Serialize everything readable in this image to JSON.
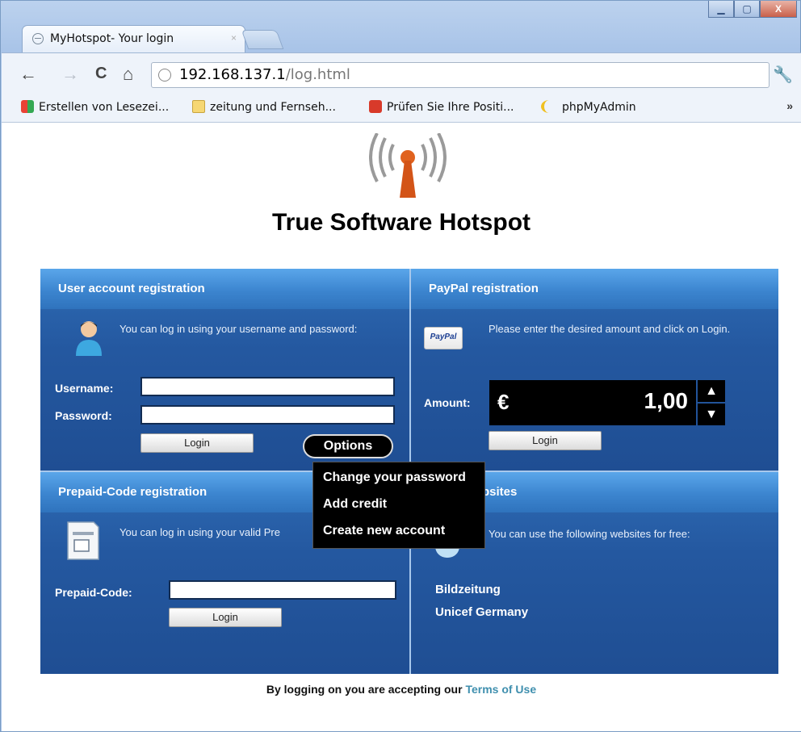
{
  "window": {
    "tab_title": "MyHotspot- Your login",
    "tab_close": "×",
    "minimize": "▁",
    "maximize": "▢",
    "close": "X"
  },
  "toolbar": {
    "url_host": "192.168.137.1",
    "url_path": "/log.html",
    "back": "←",
    "forward": "→",
    "reload": "C",
    "home": "⌂",
    "settings": "🔧"
  },
  "bookmarks": {
    "items": [
      {
        "label": "Erstellen von Lesezei...",
        "icon": "google-apps-icon"
      },
      {
        "label": "zeitung und Fernseh...",
        "icon": "folder-icon"
      },
      {
        "label": "Prüfen Sie Ihre Positi...",
        "icon": "chart-icon"
      },
      {
        "label": "phpMyAdmin",
        "icon": "phpmyadmin-icon"
      }
    ],
    "more": "»"
  },
  "page": {
    "site_title": "True Software Hotspot",
    "user_panel": {
      "title": "User account registration",
      "description": "You can log in using your username and password:",
      "username_label": "Username:",
      "username_value": "",
      "password_label": "Password:",
      "password_value": "",
      "login_label": "Login",
      "options_label": "Options"
    },
    "options_menu": {
      "items": [
        "Change your password",
        "Add credit",
        "Create new account"
      ]
    },
    "paypal_panel": {
      "title": "PayPal registration",
      "logo_text": "PayPal",
      "description": "Please enter the desired amount and click on Login.",
      "amount_label": "Amount:",
      "currency": "€",
      "amount_value": "1,00",
      "login_label": "Login"
    },
    "prepaid_panel": {
      "title": "Prepaid-Code registration",
      "description": "You can log in using your valid Pre",
      "code_label": "Prepaid-Code:",
      "code_value": "",
      "login_label": "Login"
    },
    "free_panel": {
      "title_visible": "bsites",
      "description": "You can use the following websites for free:",
      "links": [
        "Bildzeitung",
        "Unicef Germany"
      ]
    },
    "footer": {
      "text": "By logging on you are accepting our",
      "terms_link": "Terms of Use"
    }
  },
  "colors": {
    "panel_blue": "#2458a0",
    "header_blue": "#3c85cf",
    "logo_orange": "#e0621e",
    "terms_link": "#3f8fae"
  }
}
